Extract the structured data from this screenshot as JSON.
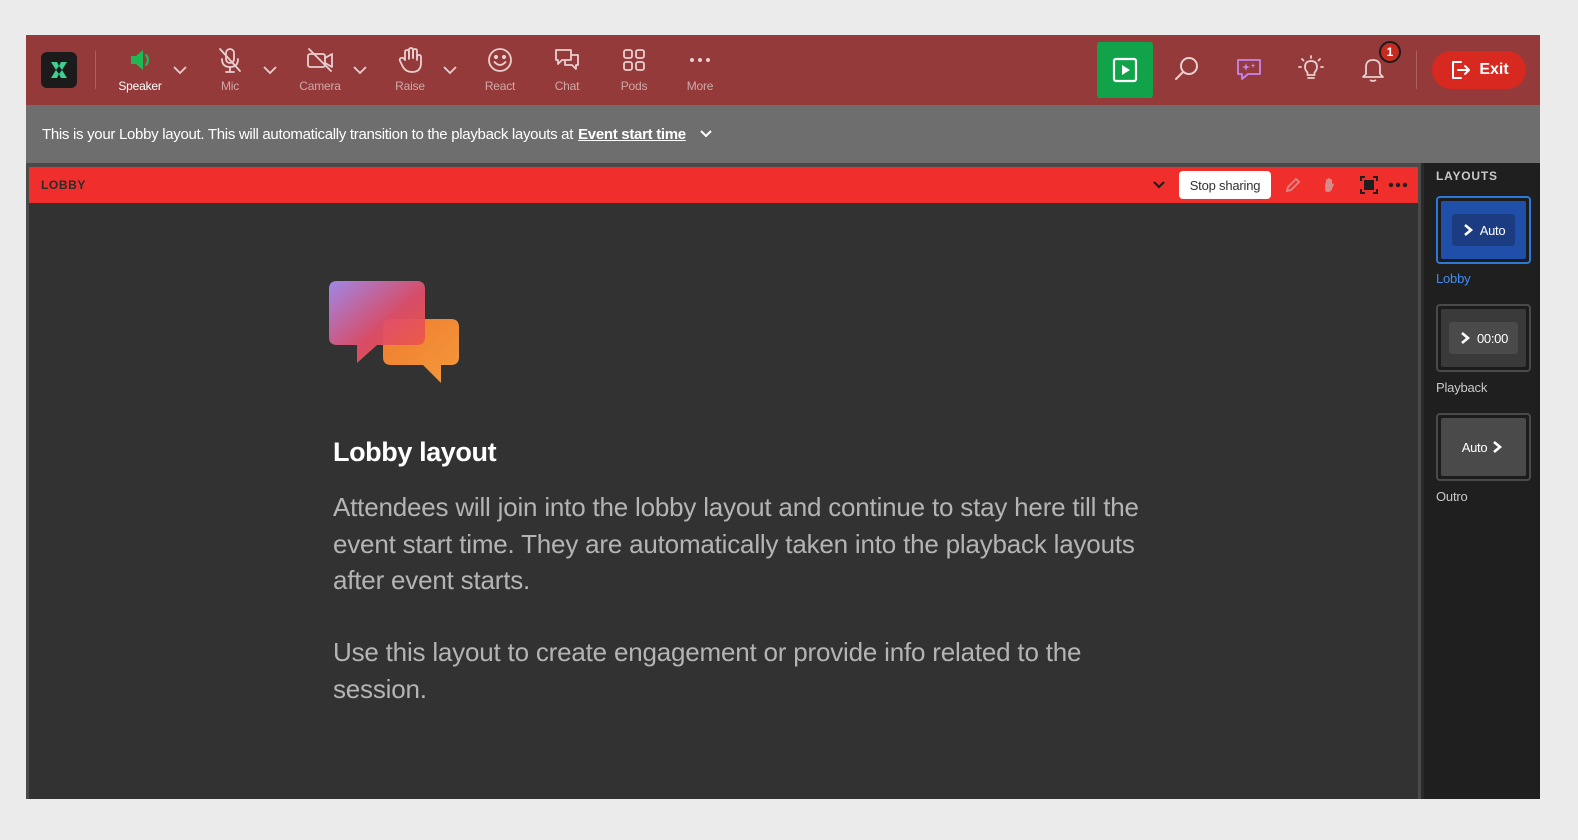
{
  "toolbar": {
    "tools": [
      {
        "id": "speaker",
        "label": "Speaker"
      },
      {
        "id": "mic",
        "label": "Mic"
      },
      {
        "id": "camera",
        "label": "Camera"
      },
      {
        "id": "raise",
        "label": "Raise"
      },
      {
        "id": "react",
        "label": "React"
      },
      {
        "id": "chat",
        "label": "Chat"
      },
      {
        "id": "pods",
        "label": "Pods"
      },
      {
        "id": "more",
        "label": "More"
      }
    ],
    "notification_count": "1",
    "exit_label": "Exit",
    "icons": [
      "app-logo-icon",
      "speaker-icon",
      "mic-off-icon",
      "camera-off-icon",
      "hand-icon",
      "smiley-icon",
      "chat-icon",
      "grid-icon",
      "more-dots-icon",
      "play-icon",
      "search-icon",
      "sparkle-chat-icon",
      "lightbulb-icon",
      "bell-icon",
      "exit-icon"
    ],
    "colors": {
      "bar": "#953a3a",
      "play": "#10a34a",
      "exit": "#d7291f",
      "speaker_active": "#1db954"
    }
  },
  "infobar": {
    "message": "This is your Lobby layout. This will automatically transition to the playback layouts at",
    "link": "Event start time"
  },
  "stage": {
    "title": "LOBBY",
    "stop_sharing_label": "Stop sharing",
    "header_color": "#f02f2d",
    "heading": "Lobby layout",
    "paragraph1": "Attendees will join into the lobby layout and continue to stay here till the event start time. They are automatically taken into the playback layouts after event starts.",
    "paragraph2": "Use this layout to create engagement or provide info related to the session."
  },
  "layouts": {
    "title": "LAYOUTS",
    "items": [
      {
        "name": "Lobby",
        "badge": "Auto",
        "active": true
      },
      {
        "name": "Playback",
        "badge": "00:00",
        "active": false
      },
      {
        "name": "Outro",
        "badge": "Auto",
        "active": false
      }
    ]
  }
}
